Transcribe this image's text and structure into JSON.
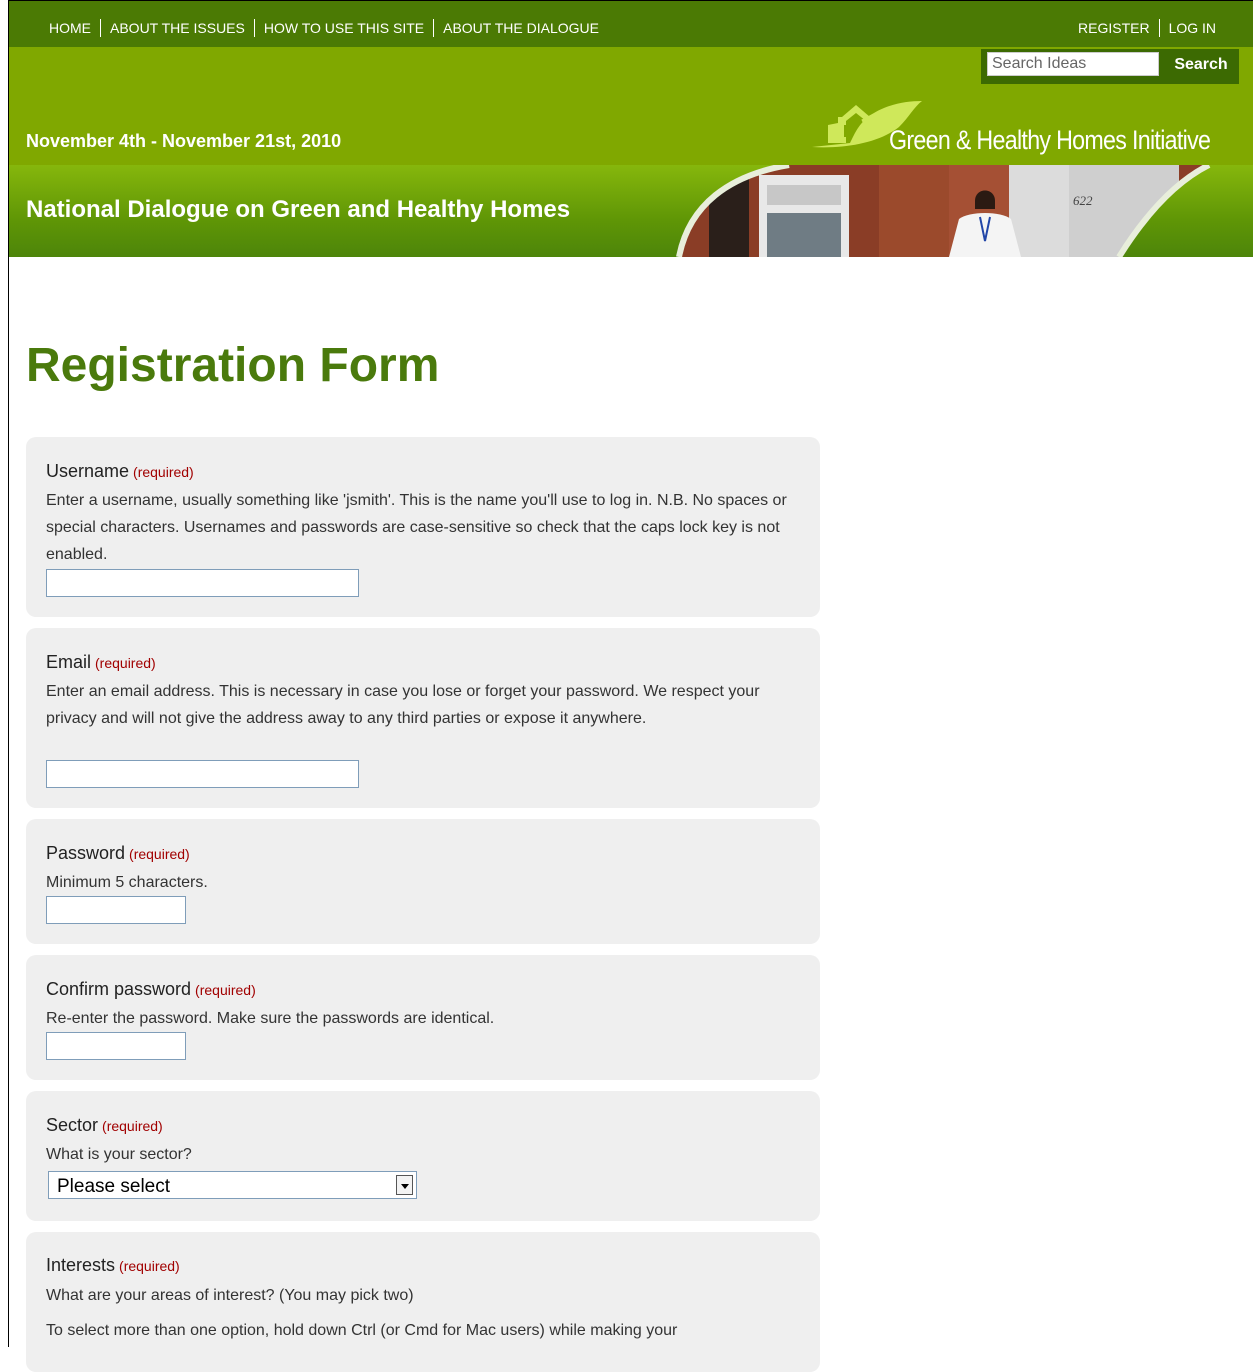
{
  "nav": {
    "left": [
      "HOME",
      "ABOUT THE ISSUES",
      "HOW TO USE THIS SITE",
      "ABOUT THE DIALOGUE"
    ],
    "right": [
      "REGISTER",
      "LOG IN"
    ]
  },
  "search": {
    "placeholder": "Search Ideas",
    "button_label": "Search"
  },
  "header": {
    "dates": "November 4th - November 21st, 2010",
    "logo_text": "Green & Healthy Homes Initiative",
    "banner_title": "National Dialogue on Green and Healthy Homes",
    "photo_number": "622"
  },
  "page": {
    "title": "Registration Form"
  },
  "form": {
    "required_tag": "(required)",
    "username": {
      "label": "Username",
      "help": "Enter a username, usually something like 'jsmith'. This is the name you'll use to log in. N.B. No spaces or special characters. Usernames and passwords are case-sensitive so check that the caps lock key is not enabled.",
      "value": ""
    },
    "email": {
      "label": "Email",
      "help": "Enter an email address. This is necessary in case you lose or forget your password. We respect your privacy and will not give the address away to any third parties or expose it anywhere.",
      "value": ""
    },
    "password": {
      "label": "Password",
      "help": "Minimum 5 characters.",
      "value": ""
    },
    "confirm": {
      "label": "Confirm password",
      "help": "Re-enter the password. Make sure the passwords are identical.",
      "value": ""
    },
    "sector": {
      "label": "Sector",
      "help": "What is your sector?",
      "selected": "Please select"
    },
    "interests": {
      "label": "Interests",
      "help": "What are your areas of interest? (You may pick two)",
      "help2": "To select more than one option, hold down Ctrl (or Cmd for Mac users) while making your"
    }
  }
}
